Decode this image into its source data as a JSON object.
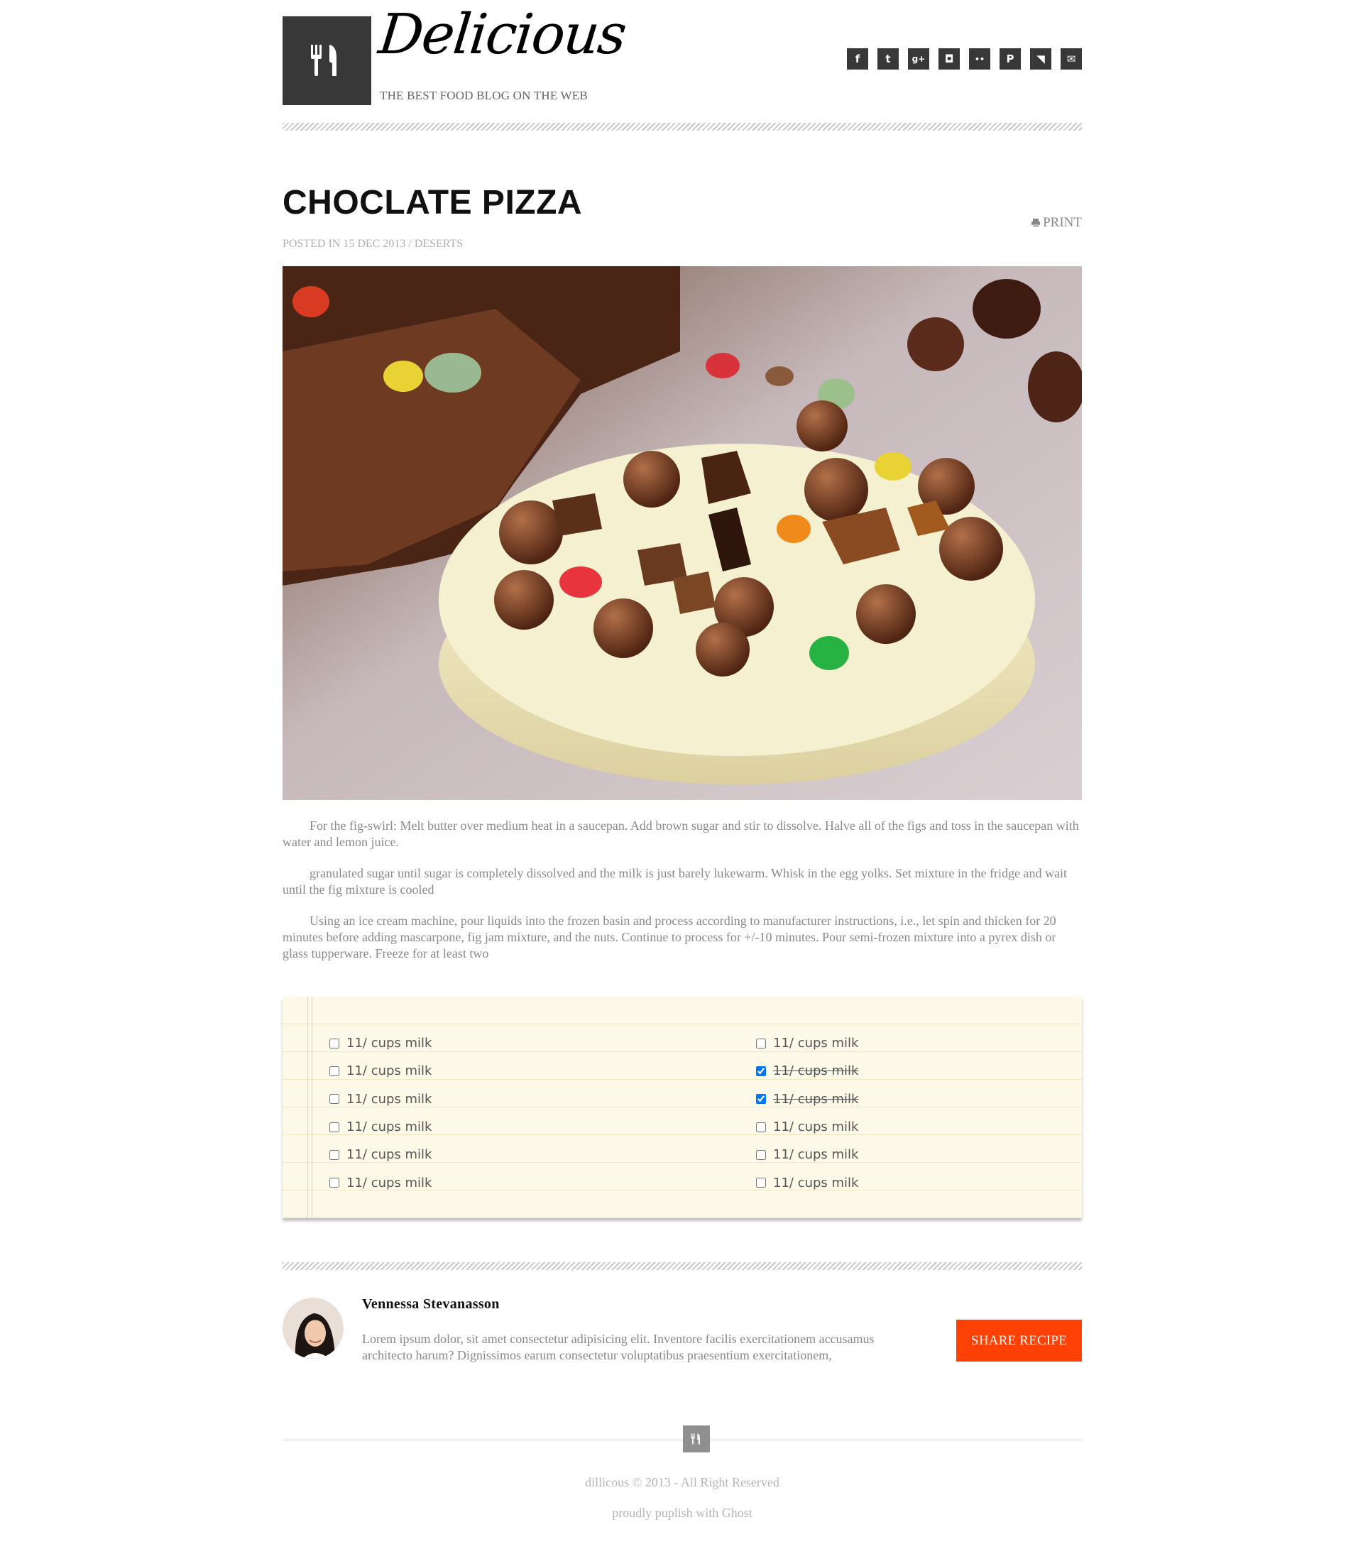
{
  "header": {
    "brand": "Delicious",
    "tagline": "THE BEST FOOD BLOG ON THE WEB",
    "social": [
      {
        "icon": "facebook-icon",
        "glyph": "f"
      },
      {
        "icon": "twitter-icon",
        "glyph": "t"
      },
      {
        "icon": "google-plus-icon",
        "glyph": "g+"
      },
      {
        "icon": "instagram-icon",
        "glyph": "◘"
      },
      {
        "icon": "flickr-icon",
        "glyph": "••"
      },
      {
        "icon": "pinterest-icon",
        "glyph": "P"
      },
      {
        "icon": "rss-icon",
        "glyph": "◥"
      },
      {
        "icon": "email-icon",
        "glyph": "✉"
      }
    ]
  },
  "article": {
    "title": "CHOCLATE PIZZA",
    "print_label": "PRINT",
    "meta": "POSTED IN 15 DEC 2013 / DESERTS",
    "paragraphs": [
      "For the fig-swirl: Melt butter over medium heat in a saucepan. Add brown sugar and stir to dissolve. Halve all of the figs and toss in the saucepan with water and lemon juice.",
      "granulated sugar until sugar is completely dissolved and the milk is just barely lukewarm. Whisk in the egg yolks. Set mixture in the fridge and wait until the fig mixture is cooled",
      "Using an ice cream machine, pour liquids into the frozen basin and process according to manufacturer instructions, i.e., let spin and thicken for 20 minutes before adding mascarpone, fig jam mixture, and the nuts. Continue to process for +/-10 minutes. Pour semi-frozen mixture into a pyrex dish or glass tupperware. Freeze for at least two"
    ]
  },
  "ingredients": {
    "left": [
      {
        "label": "11/ cups milk",
        "checked": false
      },
      {
        "label": "11/ cups milk",
        "checked": false
      },
      {
        "label": "11/ cups milk",
        "checked": false
      },
      {
        "label": "11/ cups milk",
        "checked": false
      },
      {
        "label": "11/ cups milk",
        "checked": false
      },
      {
        "label": "11/ cups milk",
        "checked": false
      }
    ],
    "right": [
      {
        "label": "11/ cups milk",
        "checked": false
      },
      {
        "label": "11/ cups milk",
        "checked": true
      },
      {
        "label": "11/ cups milk",
        "checked": true
      },
      {
        "label": "11/ cups milk",
        "checked": false
      },
      {
        "label": "11/ cups milk",
        "checked": false
      },
      {
        "label": "11/ cups milk",
        "checked": false
      }
    ]
  },
  "author": {
    "name": "Vennessa Stevanasson",
    "bio": "Lorem ipsum dolor, sit amet consectetur adipisicing elit. Inventore facilis exercitationem accusamus architecto harum? Dignissimos earum consectetur voluptatibus praesentium exercitationem,",
    "share_label": "SHARE RECIPE"
  },
  "footer": {
    "copyright": "dillicous © 2013 - All Right Reserved",
    "powered": "proudly puplish with Ghost"
  },
  "colors": {
    "accent": "#ff4106",
    "dark": "#383838",
    "notepad": "#fdf9e8"
  }
}
